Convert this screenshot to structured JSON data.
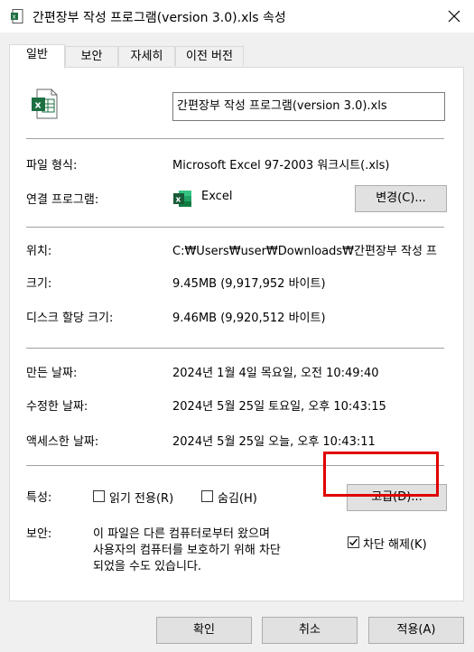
{
  "window": {
    "title": "간편장부 작성 프로그램(version 3.0).xls 속성",
    "close_icon": "close-icon"
  },
  "tabs": [
    {
      "label": "일반",
      "active": true
    },
    {
      "label": "보안",
      "active": false
    },
    {
      "label": "자세히",
      "active": false
    },
    {
      "label": "이전 버전",
      "active": false
    }
  ],
  "general": {
    "file_icon": "excel-file-icon",
    "filename": "간편장부 작성 프로그램(version 3.0).xls",
    "file_type_label": "파일 형식:",
    "file_type_value": "Microsoft Excel 97-2003 워크시트(.xls)",
    "opens_with_label": "연결 프로그램:",
    "opens_with_value": "Excel",
    "change_button": "변경(C)...",
    "location_label": "위치:",
    "location_value": "C:₩Users₩user₩Downloads₩간편장부 작성 프",
    "size_label": "크기:",
    "size_value": "9.45MB (9,917,952 바이트)",
    "disk_size_label": "디스크 할당 크기:",
    "disk_size_value": "9.46MB (9,920,512 바이트)",
    "created_label": "만든 날짜:",
    "created_value": "2024년 1월 4일 목요일, 오전 10:49:40",
    "modified_label": "수정한 날짜:",
    "modified_value": "2024년 5월 25일 토요일, 오후 10:43:15",
    "accessed_label": "액세스한 날짜:",
    "accessed_value": "2024년 5월 25일 오늘, 오후 10:43:11",
    "attributes_label": "특성:",
    "readonly_label": "읽기 전용(R)",
    "readonly_checked": false,
    "hidden_label": "숨김(H)",
    "hidden_checked": false,
    "advanced_button": "고급(D)...",
    "security_label": "보안:",
    "security_line1": "이 파일은 다른 컴퓨터로부터 왔으며",
    "security_line2": "사용자의 컴퓨터를 보호하기 위해 차단",
    "security_line3": "되었을 수도 있습니다.",
    "unblock_label": "차단 해제(K)",
    "unblock_checked": true
  },
  "footer": {
    "ok": "확인",
    "cancel": "취소",
    "apply": "적용(A)"
  },
  "colors": {
    "excel_green": "#1d6f42",
    "highlight_red": "#e00000"
  }
}
